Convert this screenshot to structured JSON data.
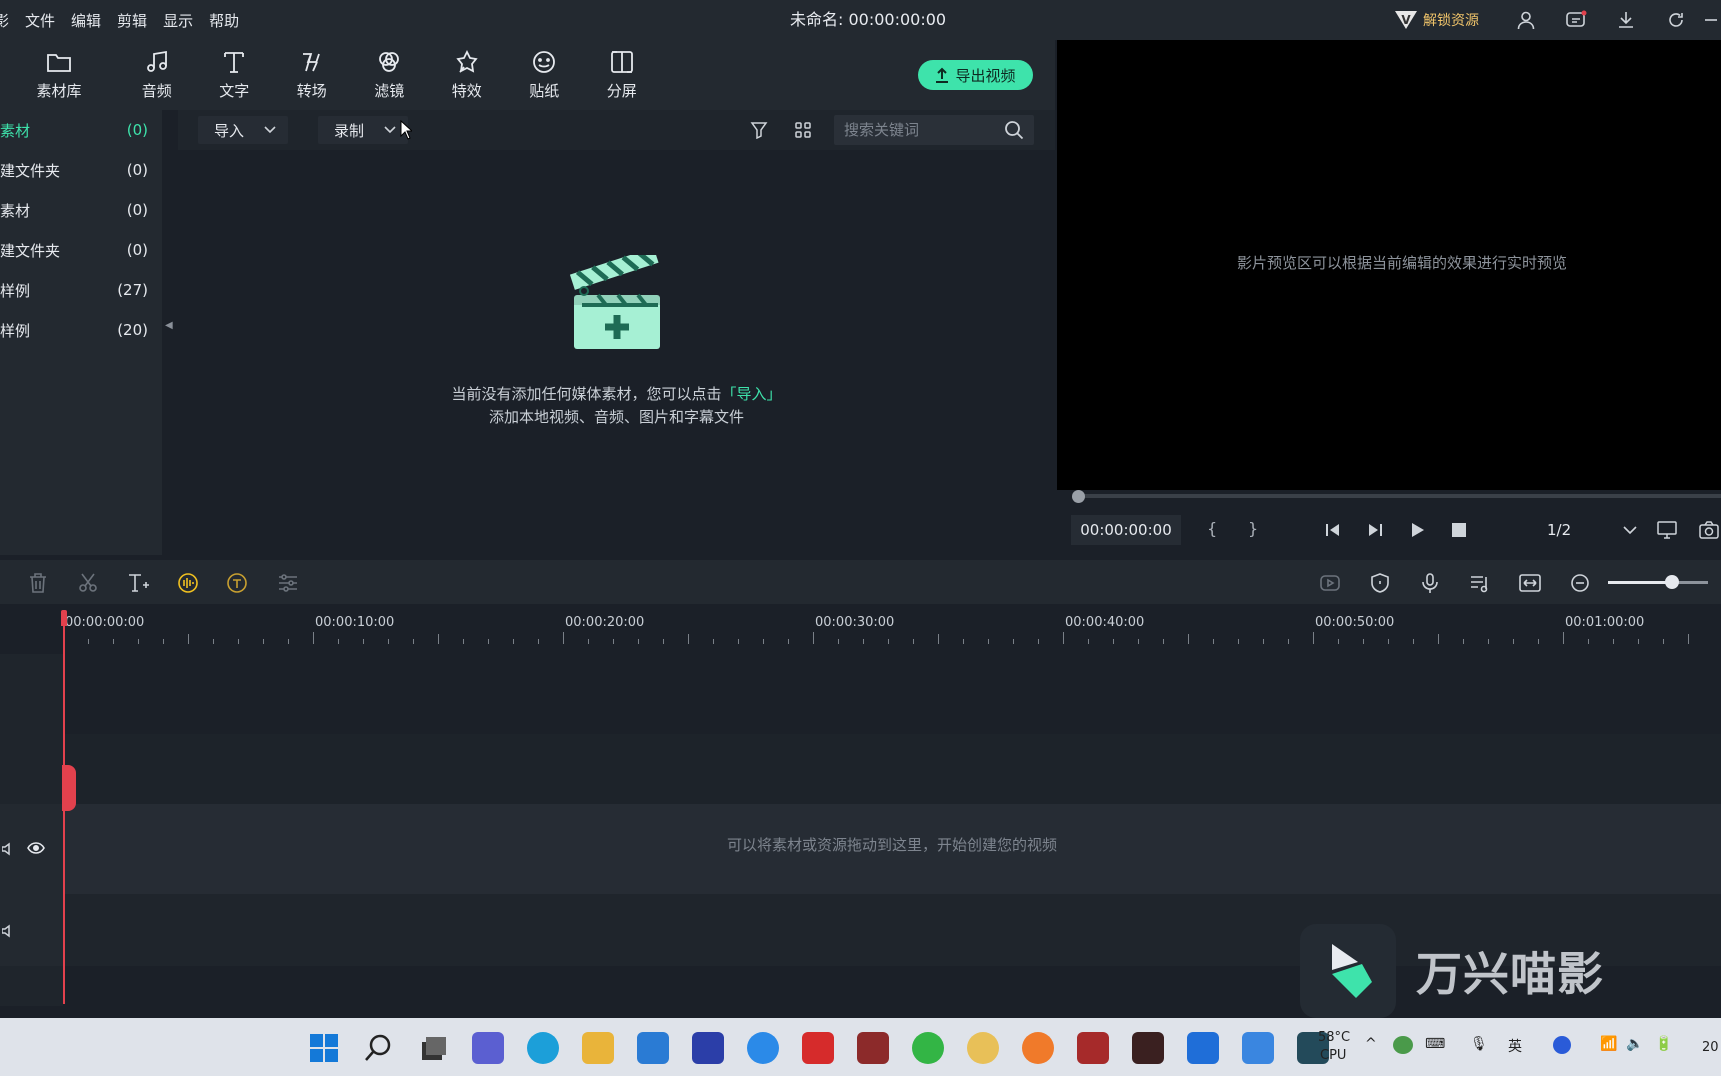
{
  "menu": [
    "影",
    "文件",
    "编辑",
    "剪辑",
    "显示",
    "帮助"
  ],
  "doc_title": "未命名: 00:00:00:00",
  "unlock_label": "解锁资源",
  "unlock_badge": "V",
  "toolbar": [
    {
      "label": "素材库",
      "icon": "folder-icon"
    },
    {
      "label": "音频",
      "icon": "music-note-icon"
    },
    {
      "label": "文字",
      "icon": "text-icon"
    },
    {
      "label": "转场",
      "icon": "transition-icon"
    },
    {
      "label": "滤镜",
      "icon": "filter-icon"
    },
    {
      "label": "特效",
      "icon": "effects-icon"
    },
    {
      "label": "贴纸",
      "icon": "sticker-icon"
    },
    {
      "label": "分屏",
      "icon": "split-screen-icon"
    }
  ],
  "export_label": "导出视频",
  "nav": [
    {
      "label": "素材",
      "count": "(0)"
    },
    {
      "label": "建文件夹",
      "count": "(0)"
    },
    {
      "label": "素材",
      "count": "(0)"
    },
    {
      "label": "建文件夹",
      "count": "(0)"
    },
    {
      "label": "样例",
      "count": "(27)"
    },
    {
      "label": "样例",
      "count": "(20)"
    }
  ],
  "import_label": "导入",
  "record_label": "录制",
  "search_placeholder": "搜索关键词",
  "empty_line1_pre": "当前没有添加任何媒体素材，您可以点击",
  "empty_line1_link": "「导入」",
  "empty_line2": "添加本地视频、音频、图片和字幕文件",
  "preview_hint": "影片预览区可以根据当前编辑的效果进行实时预览",
  "preview_timecode": "00:00:00:00",
  "preview_ratio": "1/2",
  "preview_progress": 0,
  "ruler": [
    "00:00:00:00",
    "00:00:10:00",
    "00:00:20:00",
    "00:00:30:00",
    "00:00:40:00",
    "00:00:50:00",
    "00:01:00:00"
  ],
  "drop_hint": "可以将素材或资源拖动到这里，开始创建您的视频",
  "watermark_text": "万兴喵影",
  "taskbar": {
    "temp": "58°C",
    "cpu": "CPU",
    "lang": "英",
    "clock_partial": "20"
  },
  "colors": {
    "accent": "#3ee3ab",
    "playhead": "#e2414d",
    "unlock": "#f0c46a"
  }
}
